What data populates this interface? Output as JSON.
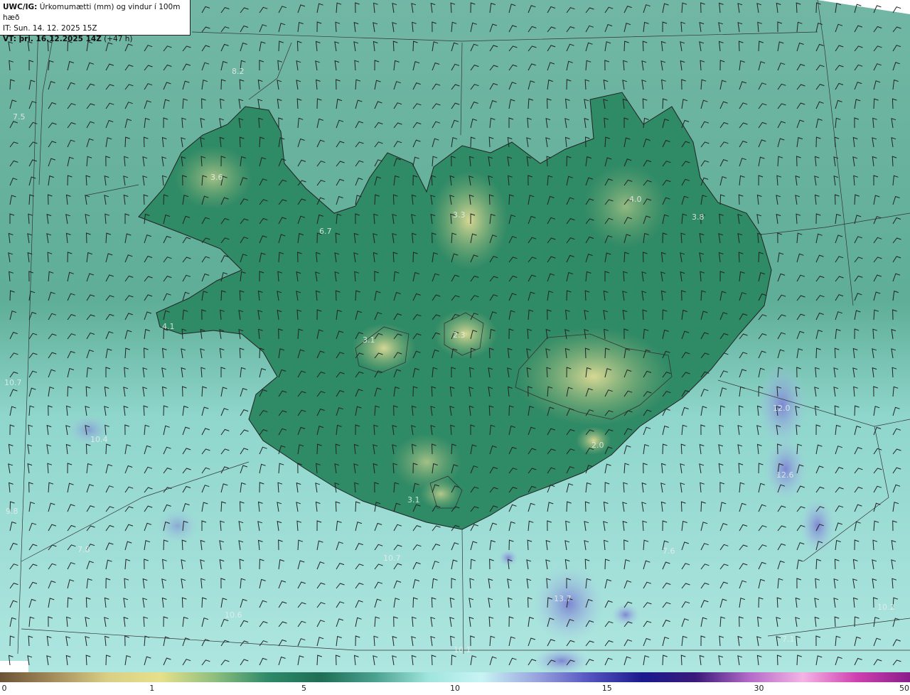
{
  "header": {
    "line1_bold": "UWC/IG:",
    "line1_rest": "Úrkomumætti (mm) og vindur í 100m hæð",
    "line2": "IT: Sun. 14. 12. 2025 15Z",
    "line3_bold": "VT: þri. 16.12.2025 14Z",
    "line3_rest": "(+47 h)"
  },
  "colors": {
    "land_base": "#2f8a66",
    "sea_north": "#6fb9a5",
    "sea_south": "#9fe0d8",
    "highland": "#c9d08a",
    "precip_blue": "#8f9ad6",
    "coastline": "#222222"
  },
  "colorbar": {
    "stops": [
      "#6b5336",
      "#a58c5c",
      "#d8cf85",
      "#e6e08a",
      "#8fbf7f",
      "#2e8a68",
      "#1f6e55",
      "#4aa18f",
      "#9fe5dd",
      "#c8f4f4",
      "#9aa6df",
      "#5555c0",
      "#1a1a8e",
      "#3a1a7a",
      "#b46ac8",
      "#f4b4e4",
      "#d040b0",
      "#8a1d8a"
    ],
    "ticks": [
      {
        "label": "0",
        "pos": 0.003
      },
      {
        "label": "1",
        "pos": 0.167
      },
      {
        "label": "5",
        "pos": 0.334
      },
      {
        "label": "10",
        "pos": 0.5
      },
      {
        "label": "15",
        "pos": 0.667
      },
      {
        "label": "30",
        "pos": 0.834
      },
      {
        "label": "50",
        "pos": 0.996
      }
    ]
  },
  "map_labels": [
    "8.2",
    "7.5",
    "3.6",
    "6.7",
    "3.3",
    "4.0",
    "3.8",
    "4.1",
    "3.1",
    "2.3",
    "10.7",
    "12.0",
    "12.6",
    "13.7",
    "9.8",
    "7.8",
    "10.7",
    "7.6",
    "10.2",
    "7.1",
    "10.1",
    "2.0",
    "3.1",
    "10.4",
    "10.6"
  ]
}
